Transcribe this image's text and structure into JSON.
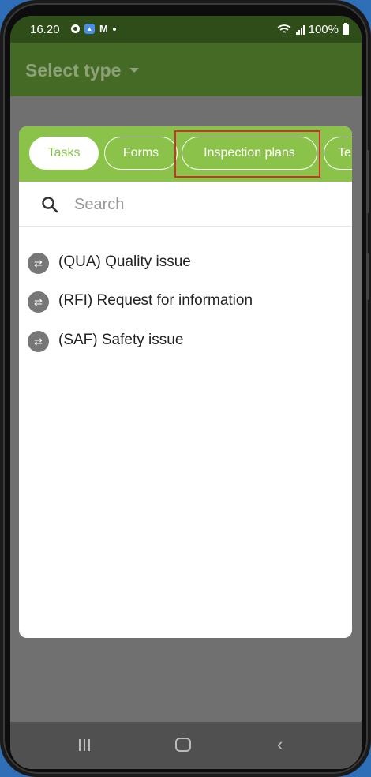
{
  "status_bar": {
    "time": "16.20",
    "battery_text": "100%"
  },
  "app_bar": {
    "title": "Select type"
  },
  "tabs": [
    {
      "label": "Tasks",
      "active": true
    },
    {
      "label": "Forms",
      "active": false
    },
    {
      "label": "Inspection plans",
      "active": false
    },
    {
      "label": "Te",
      "active": false
    }
  ],
  "search": {
    "placeholder": "Search",
    "value": ""
  },
  "items": [
    {
      "label": "(QUA) Quality issue",
      "icon": "swap-icon"
    },
    {
      "label": "(RFI) Request for information",
      "icon": "swap-icon"
    },
    {
      "label": "(SAF) Safety issue",
      "icon": "swap-icon"
    }
  ],
  "colors": {
    "status_bar": "#2f4d19",
    "app_bar": "#456a26",
    "tab_bar": "#8bc34a",
    "highlight": "#d32f2f"
  }
}
